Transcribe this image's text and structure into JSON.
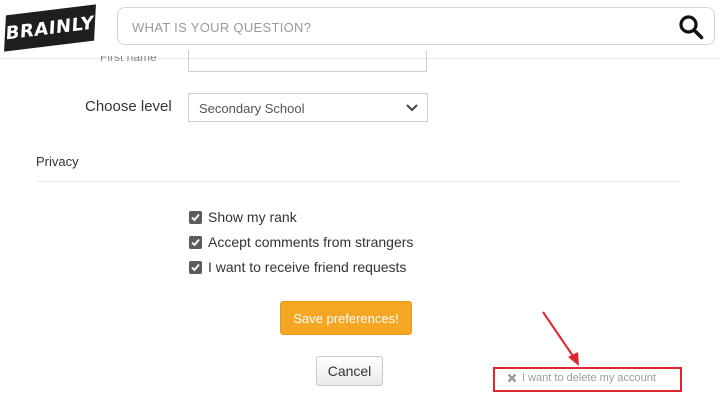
{
  "header": {
    "logo_text": "BRAINLY",
    "search_placeholder": "WHAT IS YOUR QUESTION?",
    "search_icon": "search-icon"
  },
  "form": {
    "cut_field_label": "First name",
    "level_label": "Choose level",
    "level_value": "Secondary School",
    "level_options": [
      "Secondary School"
    ]
  },
  "privacy": {
    "heading": "Privacy",
    "options": [
      {
        "label": "Show my rank",
        "checked": true
      },
      {
        "label": "Accept comments from strangers",
        "checked": true
      },
      {
        "label": "I want to receive friend requests",
        "checked": true
      }
    ]
  },
  "actions": {
    "save_label": "Save preferences!",
    "cancel_label": "Cancel",
    "delete_label": "I want to delete my account"
  },
  "colors": {
    "accent": "#f5a623",
    "highlight": "#e0252e",
    "logo_bg": "#1e1e1e"
  }
}
